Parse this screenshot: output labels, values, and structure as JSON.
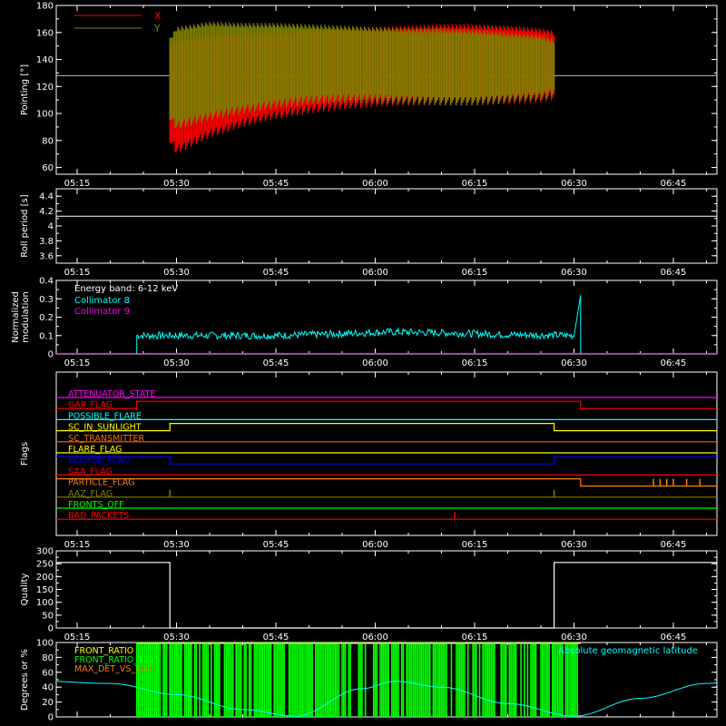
{
  "chart_data": [
    {
      "type": "line",
      "ylabel": "Pointing [°]",
      "ylim": [
        55,
        180
      ],
      "yticks": [
        60,
        80,
        100,
        120,
        140,
        160,
        180
      ],
      "x_tick_labels": [
        "05:15",
        "05:30",
        "05:45",
        "06:00",
        "06:15",
        "06:30",
        "06:45"
      ],
      "legend": [
        {
          "name": "X",
          "color": "#ff0000"
        },
        {
          "name": "Y",
          "color": "#808000"
        }
      ],
      "reference_line": 128,
      "series": [
        {
          "name": "X",
          "color": "#ff0000",
          "x": [
            "05:29",
            "05:30",
            "05:35",
            "05:40",
            "05:45",
            "05:50",
            "05:55",
            "06:00",
            "06:05",
            "06:10",
            "06:15",
            "06:20",
            "06:25",
            "06:27"
          ],
          "upper": [
            150,
            155,
            158,
            160,
            161,
            162,
            163,
            164,
            165,
            166,
            166,
            165,
            163,
            161
          ],
          "lower": [
            78,
            70,
            82,
            90,
            96,
            100,
            103,
            105,
            106,
            106,
            106,
            107,
            108,
            110
          ]
        },
        {
          "name": "Y",
          "color": "#808000",
          "x": [
            "05:29",
            "05:30",
            "05:35",
            "05:40",
            "05:45",
            "05:50",
            "05:55",
            "06:00",
            "06:05",
            "06:10",
            "06:15",
            "06:20",
            "06:25",
            "06:27"
          ],
          "upper": [
            156,
            164,
            168,
            167,
            167,
            166,
            165,
            164,
            163,
            163,
            162,
            160,
            158,
            155
          ],
          "lower": [
            95,
            88,
            95,
            100,
            104,
            107,
            108,
            108,
            107,
            106,
            106,
            108,
            110,
            113
          ]
        }
      ]
    },
    {
      "type": "line",
      "ylabel": "Roll period [s]",
      "ylim": [
        3.5,
        4.5
      ],
      "yticks": [
        3.6,
        3.8,
        4.0,
        4.2,
        4.4
      ],
      "x_tick_labels": [
        "05:15",
        "05:30",
        "05:45",
        "06:00",
        "06:15",
        "06:30",
        "06:45"
      ],
      "series": [
        {
          "name": "roll",
          "color": "#ffffff",
          "x": [
            "05:10",
            "06:55"
          ],
          "values": [
            4.13,
            4.13
          ]
        }
      ]
    },
    {
      "type": "line",
      "ylabel": "Normalized modulation",
      "ylim": [
        0,
        0.4
      ],
      "yticks": [
        0,
        0.1,
        0.2,
        0.3,
        0.4
      ],
      "x_tick_labels": [
        "05:15",
        "05:30",
        "05:45",
        "06:00",
        "06:15",
        "06:30",
        "06:45"
      ],
      "annotation": "Energy band: 6-12 keV",
      "legend": [
        {
          "name": "Collimator 8",
          "color": "#00ffff"
        },
        {
          "name": "Collimator 9",
          "color": "#ff00ff"
        }
      ],
      "series": [
        {
          "name": "Collimator 8",
          "color": "#00ffff",
          "x": [
            "05:24",
            "05:35",
            "05:45",
            "05:55",
            "06:02",
            "06:10",
            "06:20",
            "06:30"
          ],
          "values": [
            0.1,
            0.1,
            0.1,
            0.11,
            0.12,
            0.115,
            0.105,
            0.1
          ],
          "spike": {
            "x": "06:31",
            "value": 0.32
          }
        },
        {
          "name": "Collimator 9",
          "color": "#ff00ff",
          "x": [
            "05:10",
            "06:55"
          ],
          "values": [
            0.0,
            0.0
          ]
        }
      ]
    },
    {
      "type": "line",
      "ylabel": "Flags",
      "x_tick_labels": [
        "05:15",
        "05:30",
        "05:45",
        "06:00",
        "06:15",
        "06:30",
        "06:45"
      ],
      "flags": [
        {
          "name": "ATTENUATOR_STATE",
          "color": "#ff00ff",
          "steps": []
        },
        {
          "name": "GAP_FLAG",
          "color": "#ff0000",
          "steps": [
            [
              "05:10",
              0
            ],
            [
              "05:24",
              1
            ],
            [
              "06:31",
              0
            ]
          ]
        },
        {
          "name": "POSSIBLE_FLARE",
          "color": "#00ffff",
          "steps": []
        },
        {
          "name": "SC_IN_SUNLIGHT",
          "color": "#ffff00",
          "steps": [
            [
              "05:10",
              0
            ],
            [
              "05:29",
              1
            ],
            [
              "06:27",
              0
            ]
          ]
        },
        {
          "name": "SC_TRANSMITTER",
          "color": "#ff6600",
          "steps": []
        },
        {
          "name": "FLARE_FLAG",
          "color": "#ffff00",
          "steps": []
        },
        {
          "name": "ECLIPSE_FLAG",
          "color": "#0000ff",
          "steps": [
            [
              "05:10",
              1
            ],
            [
              "05:29",
              0
            ],
            [
              "06:27",
              1
            ]
          ]
        },
        {
          "name": "SAA_FLAG",
          "color": "#ff0000",
          "steps": []
        },
        {
          "name": "PARTICLE_FLAG",
          "color": "#ff8000",
          "steps": [
            [
              "05:10",
              1
            ],
            [
              "06:31",
              0
            ]
          ],
          "spikes": [
            "06:42",
            "06:43",
            "06:44",
            "06:45",
            "06:47",
            "06:49"
          ]
        },
        {
          "name": "AAZ_FLAG",
          "color": "#808000",
          "steps": [],
          "spikes": [
            "05:29",
            "06:27"
          ]
        },
        {
          "name": "FRONTS_OFF",
          "color": "#00ff00",
          "steps": []
        },
        {
          "name": "BAD_PACKETS",
          "color": "#ff0000",
          "steps": [],
          "spikes": [
            "06:12"
          ]
        }
      ]
    },
    {
      "type": "line",
      "ylabel": "Quality",
      "ylim": [
        0,
        300
      ],
      "yticks": [
        0,
        50,
        100,
        150,
        200,
        250,
        300
      ],
      "x_tick_labels": [
        "05:15",
        "05:30",
        "05:45",
        "06:00",
        "06:15",
        "06:30",
        "06:45"
      ],
      "series": [
        {
          "name": "Quality",
          "color": "#ffffff",
          "x": [
            "05:10",
            "05:29",
            "05:29",
            "06:27",
            "06:27",
            "06:55"
          ],
          "values": [
            255,
            255,
            0,
            0,
            255,
            255
          ]
        }
      ]
    },
    {
      "type": "line",
      "ylabel": "Degrees or %",
      "ylim": [
        0,
        100
      ],
      "yticks": [
        0,
        20,
        40,
        60,
        80,
        100
      ],
      "legend": [
        {
          "name": "FRONT_RATIO",
          "color": "#ffff00"
        },
        {
          "name": "FRONT_RATIO_1225",
          "color": "#00ff00"
        },
        {
          "name": "MAX_DET_VS_TOT",
          "color": "#ff8000"
        },
        {
          "name": "Absolute geomagnetic latitude",
          "color": "#00ffff"
        }
      ],
      "green_span": [
        "05:24",
        "06:31"
      ],
      "series": [
        {
          "name": "Absolute geomagnetic latitude",
          "color": "#00ffff",
          "x": [
            "05:10",
            "05:20",
            "05:30",
            "05:40",
            "05:48",
            "05:58",
            "06:03",
            "06:10",
            "06:20",
            "06:30",
            "06:40",
            "06:50",
            "06:55"
          ],
          "values": [
            48,
            45,
            30,
            10,
            1,
            38,
            48,
            40,
            18,
            1,
            25,
            45,
            49
          ]
        }
      ]
    }
  ]
}
